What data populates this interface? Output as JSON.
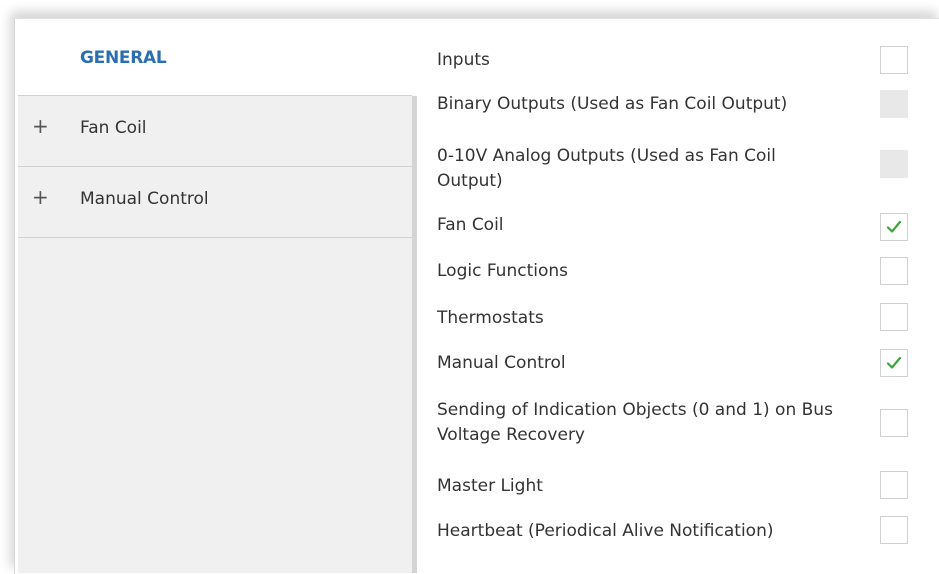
{
  "nav": {
    "general": "GENERAL",
    "items": [
      {
        "label": "Fan Coil",
        "expand_icon": "plus-icon",
        "expand_glyph": "+"
      },
      {
        "label": "Manual Control",
        "expand_icon": "plus-icon",
        "expand_glyph": "+"
      }
    ]
  },
  "colors": {
    "accent": "#2b6fb0",
    "check": "#3aa83a",
    "nav_bg": "#f0f0f0"
  },
  "options": [
    {
      "label": "Inputs",
      "checked": false,
      "disabled": false
    },
    {
      "label": "Binary Outputs (Used as Fan Coil Output)",
      "checked": false,
      "disabled": true
    },
    {
      "label": "0-10V Analog Outputs (Used as Fan Coil Output)",
      "checked": false,
      "disabled": true
    },
    {
      "label": "Fan Coil",
      "checked": true,
      "disabled": false
    },
    {
      "label": "Logic Functions",
      "checked": false,
      "disabled": false
    },
    {
      "label": "Thermostats",
      "checked": false,
      "disabled": false
    },
    {
      "label": "Manual Control",
      "checked": true,
      "disabled": false
    },
    {
      "label": "Sending of Indication Objects (0 and 1) on Bus Voltage Recovery",
      "checked": false,
      "disabled": false
    },
    {
      "label": "Master Light",
      "checked": false,
      "disabled": false
    },
    {
      "label": "Heartbeat (Periodical Alive Notification)",
      "checked": false,
      "disabled": false
    }
  ]
}
